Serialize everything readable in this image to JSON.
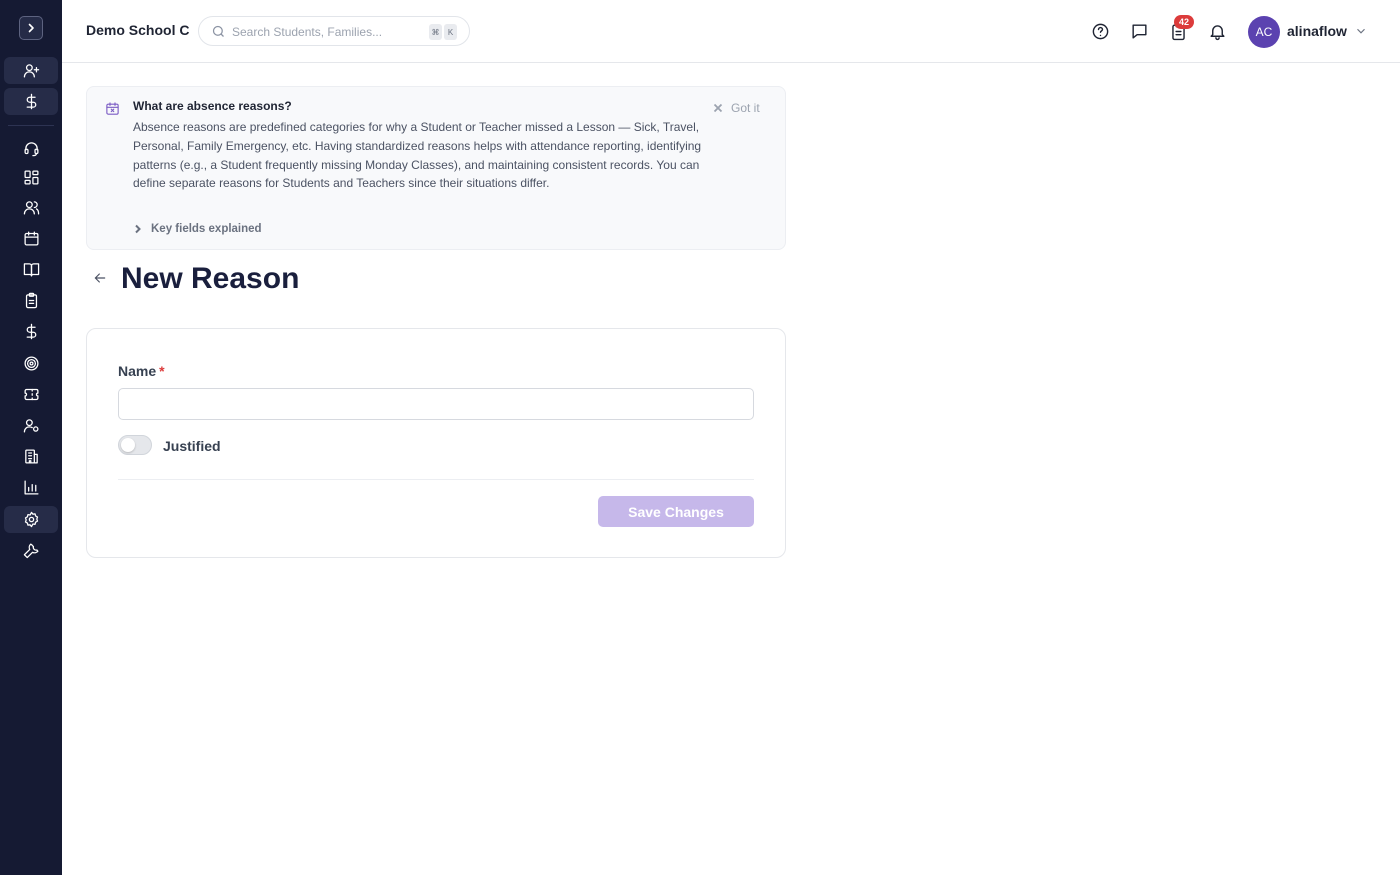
{
  "header": {
    "school_name": "Demo School C",
    "search": {
      "placeholder": "Search Students, Families...",
      "shortcut_keys": [
        "⌘",
        "K"
      ]
    },
    "notification_count": "42",
    "user": {
      "initials": "AC",
      "name": "alinaflow"
    }
  },
  "sidebar": {
    "items": [
      {
        "name": "add-user",
        "icon": "user-plus-icon"
      },
      {
        "name": "billing",
        "icon": "dollar-icon"
      },
      {
        "name": "support",
        "icon": "headset-icon"
      },
      {
        "name": "dashboard",
        "icon": "grid-icon"
      },
      {
        "name": "people",
        "icon": "users-icon"
      },
      {
        "name": "calendar",
        "icon": "calendar-icon"
      },
      {
        "name": "courses",
        "icon": "book-icon"
      },
      {
        "name": "tasks",
        "icon": "clipboard-icon"
      },
      {
        "name": "finance",
        "icon": "dollar-icon"
      },
      {
        "name": "goals",
        "icon": "target-icon"
      },
      {
        "name": "tickets",
        "icon": "ticket-icon"
      },
      {
        "name": "user-settings",
        "icon": "user-gear-icon"
      },
      {
        "name": "buildings",
        "icon": "building-icon"
      },
      {
        "name": "reports",
        "icon": "bar-chart-icon"
      },
      {
        "name": "settings",
        "icon": "gear-icon",
        "active": true
      },
      {
        "name": "tools",
        "icon": "wrench-icon"
      }
    ]
  },
  "info": {
    "title": "What are absence reasons?",
    "body": "Absence reasons are predefined categories for why a Student or Teacher missed a Lesson — Sick, Travel, Personal, Family Emergency, etc. Having standardized reasons helps with attendance reporting, identifying patterns (e.g., a Student frequently missing Monday Classes), and maintaining consistent records. You can define separate reasons for Students and Teachers since their situations differ.",
    "dismiss_label": "Got it",
    "expander_label": "Key fields explained"
  },
  "page": {
    "title": "New Reason"
  },
  "form": {
    "name_label": "Name",
    "required_mark": "*",
    "name_value": "",
    "justified_label": "Justified",
    "justified_on": false,
    "save_label": "Save Changes"
  },
  "colors": {
    "sidebar_bg": "#151a33",
    "accent": "#5b42b0",
    "save_disabled": "#c6b8ea",
    "badge": "#dc3b3b"
  }
}
